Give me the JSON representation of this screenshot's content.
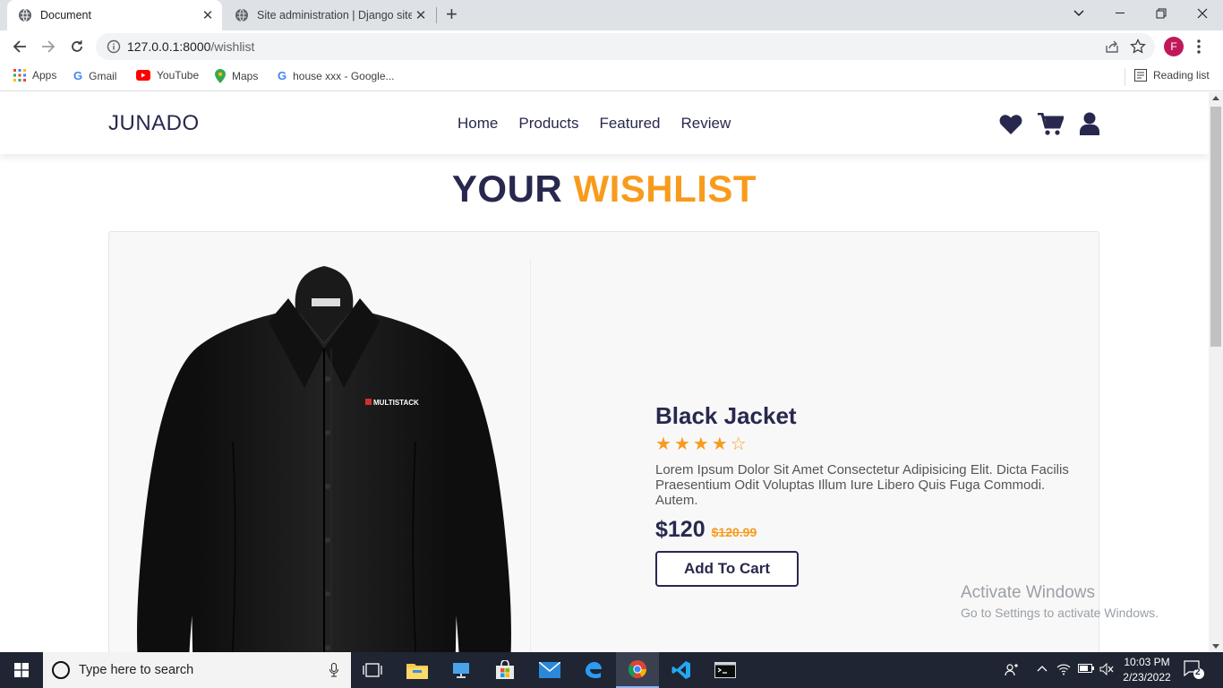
{
  "browser": {
    "tabs": [
      {
        "title": "Document",
        "active": true
      },
      {
        "title": "Site administration | Django site admin",
        "active": false
      }
    ],
    "url_host": "127.0.0.1:8000",
    "url_path": "/wishlist",
    "profile_initial": "F",
    "bookmarks": [
      {
        "label": "Apps",
        "icon": "apps-grid-icon"
      },
      {
        "label": "Gmail",
        "icon": "google-icon"
      },
      {
        "label": "YouTube",
        "icon": "youtube-icon"
      },
      {
        "label": "Maps",
        "icon": "maps-pin-icon"
      },
      {
        "label": "house xxx - Google...",
        "icon": "google-icon"
      }
    ],
    "reading_list": "Reading list"
  },
  "site": {
    "logo": "JUNADO",
    "nav": [
      "Home",
      "Products",
      "Featured",
      "Review"
    ],
    "title_part1": "YOUR",
    "title_part2": "WISHLIST",
    "colors": {
      "primary": "#28284f",
      "accent": "#f89b1c"
    }
  },
  "product": {
    "name": "Black Jacket",
    "rating": 4,
    "rating_max": 5,
    "description": "Lorem Ipsum Dolor Sit Amet Consectetur Adipisicing Elit. Dicta Facilis Praesentium Odit Voluptas Illum Iure Libero Quis Fuga Commodi. Autem.",
    "price": "$120",
    "old_price": "$120.99",
    "button": "Add To Cart",
    "image_brand": "MULTISTACK"
  },
  "watermark": {
    "line1": "Activate Windows",
    "line2": "Go to Settings to activate Windows."
  },
  "taskbar": {
    "search_placeholder": "Type here to search",
    "time": "10:03 PM",
    "date": "2/23/2022",
    "notification_count": "2"
  }
}
